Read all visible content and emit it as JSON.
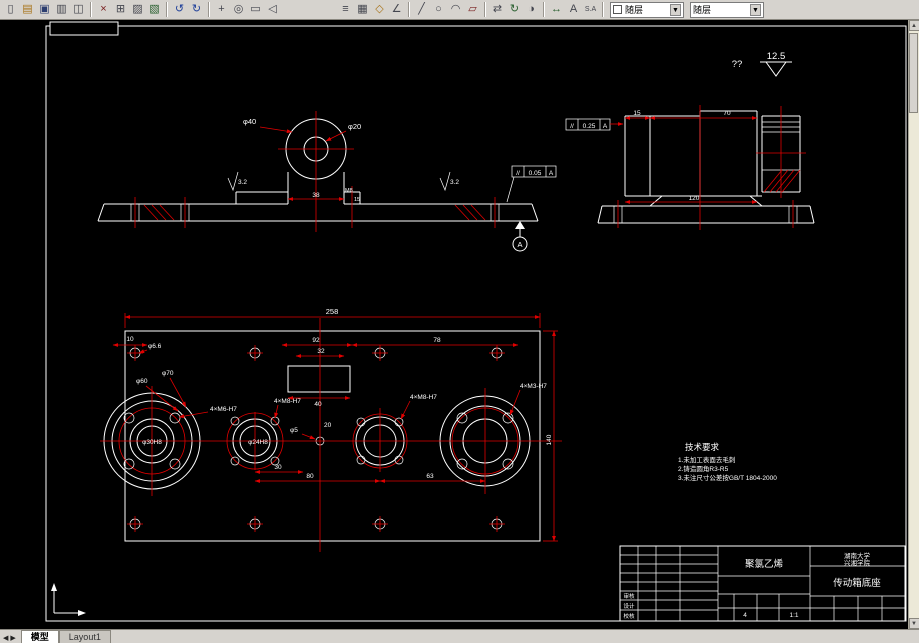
{
  "toolbar": {
    "items": [
      {
        "name": "new-file-icon",
        "glyph": "▯",
        "color": "#44464f"
      },
      {
        "name": "open-file-icon",
        "glyph": "▤",
        "color": "#a8741a"
      },
      {
        "name": "save-icon",
        "glyph": "▣",
        "color": "#2c3e70"
      },
      {
        "name": "print-icon",
        "glyph": "▥",
        "color": "#44464f"
      },
      {
        "name": "plot-preview-icon",
        "glyph": "◫",
        "color": "#44464f"
      },
      {
        "type": "sep"
      },
      {
        "name": "cut-icon",
        "glyph": "×",
        "color": "#7a2020"
      },
      {
        "name": "copy-icon",
        "glyph": "⊞",
        "color": "#44464f"
      },
      {
        "name": "paste-icon",
        "glyph": "▨",
        "color": "#44464f"
      },
      {
        "name": "match-properties-icon",
        "glyph": "▧",
        "color": "#2a6030"
      },
      {
        "type": "sep"
      },
      {
        "name": "undo-icon",
        "glyph": "↺",
        "color": "#20409a"
      },
      {
        "name": "redo-icon",
        "glyph": "↻",
        "color": "#20409a"
      },
      {
        "type": "sep"
      },
      {
        "name": "pan-icon",
        "glyph": "+",
        "color": "#44464f"
      },
      {
        "name": "zoom-realtime-icon",
        "glyph": "◎",
        "color": "#44464f"
      },
      {
        "name": "zoom-window-icon",
        "glyph": "▭",
        "color": "#44464f"
      },
      {
        "name": "zoom-previous-icon",
        "glyph": "◁",
        "color": "#44464f"
      },
      {
        "type": "space",
        "w": 56
      },
      {
        "name": "layers-icon",
        "glyph": "≡",
        "color": "#44464f"
      },
      {
        "name": "layer-states-icon",
        "glyph": "▦",
        "color": "#44464f"
      },
      {
        "name": "osnap-icon",
        "glyph": "◇",
        "color": "#a8741a"
      },
      {
        "name": "ortho-icon",
        "glyph": "∠",
        "color": "#44464f"
      },
      {
        "type": "sep"
      },
      {
        "name": "line-tool-icon",
        "glyph": "╱",
        "color": "#44464f"
      },
      {
        "name": "circle-tool-icon",
        "glyph": "○",
        "color": "#44464f"
      },
      {
        "name": "arc-tool-icon",
        "glyph": "◠",
        "color": "#44464f"
      },
      {
        "name": "erase-tool-icon",
        "glyph": "▱",
        "color": "#7a2020"
      },
      {
        "type": "sep"
      },
      {
        "name": "move-tool-icon",
        "glyph": "⇄",
        "color": "#44464f"
      },
      {
        "name": "rotate-tool-icon",
        "glyph": "↻",
        "color": "#2a6030"
      },
      {
        "name": "mirror-tool-icon",
        "glyph": "◑",
        "color": "#44464f"
      },
      {
        "type": "sep"
      },
      {
        "name": "dim-linear-icon",
        "glyph": "↔",
        "color": "#2a6030"
      },
      {
        "name": "text-tool-icon",
        "glyph": "A",
        "color": "#44464f"
      },
      {
        "name": "dim-style-icon",
        "glyph": "S.A",
        "color": "#44464f"
      },
      {
        "type": "sep"
      },
      {
        "type": "combo",
        "name": "color-control",
        "swatch": "#ffffff",
        "label": "随层"
      },
      {
        "type": "combo",
        "name": "linetype-control",
        "label": "随层"
      }
    ]
  },
  "scrollbar": {
    "up": "▲",
    "down": "▼"
  },
  "tabs": {
    "nav_prev": "◀",
    "nav_next": "▶",
    "model": "模型",
    "layout": "Layout1"
  },
  "drawing": {
    "roughness": {
      "prefix": "??",
      "value": "12.5"
    },
    "front": {
      "dia40": "φ40",
      "dia20": "φ20",
      "dim38": "38",
      "rough_left": "3.2",
      "rough_right": "3.2",
      "thread": "M8",
      "thread_depth": "15",
      "gdt": {
        "sym": "//",
        "tol": "0.05",
        "datum": "A"
      },
      "datum_label": "A"
    },
    "side": {
      "gdt": {
        "sym": "//",
        "tol": "0.25",
        "datum": "A"
      },
      "dim15": "15",
      "dim70": "70",
      "dim120": "120"
    },
    "plan": {
      "dim258": "258",
      "dim92": "92",
      "dim78": "78",
      "dim32": "32",
      "dim10": "10",
      "dia66": "φ6.6",
      "dim40": "40",
      "dia70": "φ70",
      "dia60": "φ60",
      "dia30": "φ30H8",
      "dia24": "φ24H8",
      "m6": "4×M6-H7",
      "m8a": "4×M8-H7",
      "m8b": "4×M8-H7",
      "m3": "4×M3-H7",
      "dia5": "φ5",
      "dim20": "20",
      "dim30": "30",
      "dim80": "80",
      "dim63": "63",
      "dim140": "140"
    },
    "notes": {
      "title": "技术要求",
      "item1": "1.未加工表面去毛刺",
      "item2": "2.铸造圆角R3-R5",
      "item3": "3.未注尺寸公差按GB/T 1804-2000"
    },
    "title_block": {
      "material": "聚氯乙烯",
      "org1": "湖南大学",
      "org2": "兴湘学院",
      "part": "传动箱底座",
      "qty": "4",
      "scale": "1:1",
      "row1": "审核",
      "row2": "设计",
      "row3": "校核"
    }
  }
}
